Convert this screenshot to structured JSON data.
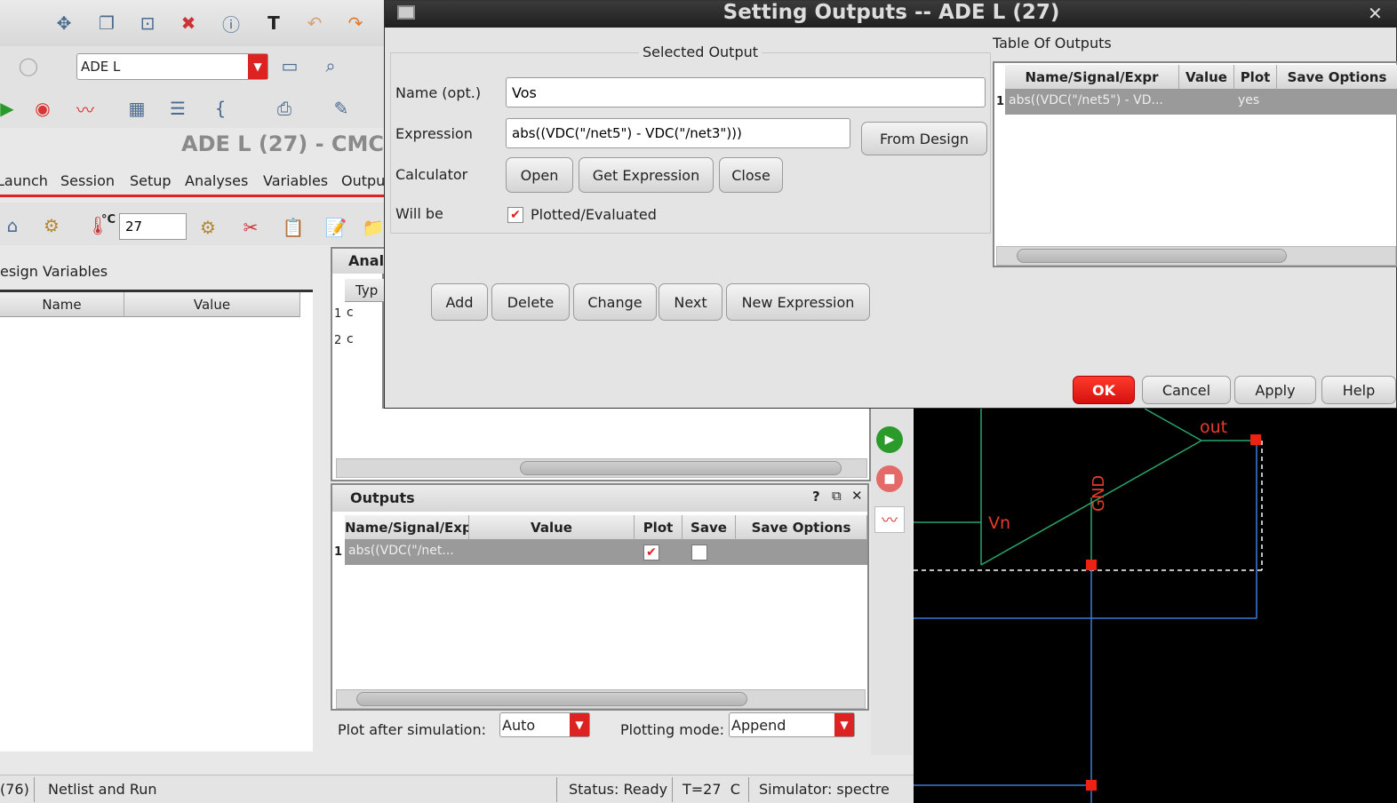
{
  "main_window": {
    "toolbar_select": "ADE L",
    "title": "ADE L (27) - CMC",
    "menu": [
      "Launch",
      "Session",
      "Setup",
      "Analyses",
      "Variables",
      "Outpu"
    ],
    "temperature": "27",
    "temp_unit": "°C",
    "design_variables": {
      "title": "esign Variables",
      "columns": [
        "Name",
        "Value"
      ]
    },
    "analyses": {
      "title": "Anal",
      "type_col": "Typ",
      "rows": [
        {
          "num": "1",
          "type": "c"
        },
        {
          "num": "2",
          "type": "c"
        }
      ]
    },
    "outputs": {
      "title": "Outputs",
      "columns": [
        "Name/Signal/Exp",
        "Value",
        "Plot",
        "Save",
        "Save Options"
      ],
      "rows": [
        {
          "num": "1",
          "name": "abs((VDC(\"/net...",
          "value": "",
          "plot": true,
          "save": false
        }
      ],
      "plot_after_label": "Plot after simulation:",
      "plot_after_value": "Auto",
      "plotting_mode_label": "Plotting mode:",
      "plotting_mode_value": "Append"
    },
    "status_bar": {
      "count": "(76)",
      "action": "Netlist and Run",
      "status": "Status: Ready",
      "temp": "T=27  C",
      "simulator": "Simulator: spectre"
    }
  },
  "dialog": {
    "title": "Setting Outputs -- ADE L (27)",
    "selected_output_label": "Selected Output",
    "name_label": "Name (opt.)",
    "name_value": "Vos",
    "expression_label": "Expression",
    "expression_value": "abs((VDC(\"/net5\") - VDC(\"/net3\")))",
    "from_design": "From Design",
    "calculator_label": "Calculator",
    "calc_buttons": [
      "Open",
      "Get Expression",
      "Close"
    ],
    "will_be_label": "Will be",
    "plotted_label": "Plotted/Evaluated",
    "action_buttons": [
      "Add",
      "Delete",
      "Change",
      "Next",
      "New Expression"
    ],
    "table_title": "Table Of Outputs",
    "table_columns": [
      "Name/Signal/Expr",
      "Value",
      "Plot",
      "Save Options"
    ],
    "table_rows": [
      {
        "num": "1",
        "name": "abs((VDC(\"/net5\") - VD...",
        "value": "",
        "plot": "yes",
        "save_options": ""
      }
    ],
    "ok": "OK",
    "cancel": "Cancel",
    "apply": "Apply",
    "help": "Help"
  },
  "schematic": {
    "labels": [
      "out",
      "Vn",
      "GND"
    ]
  }
}
